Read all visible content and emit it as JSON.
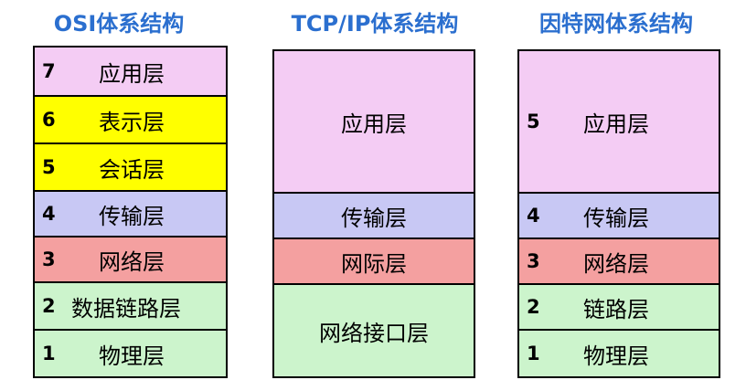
{
  "osi": {
    "title": "OSI体系结构",
    "layers": [
      {
        "num": "7",
        "name": "应用层"
      },
      {
        "num": "6",
        "name": "表示层"
      },
      {
        "num": "5",
        "name": "会话层"
      },
      {
        "num": "4",
        "name": "传输层"
      },
      {
        "num": "3",
        "name": "网络层"
      },
      {
        "num": "2",
        "name": "数据链路层"
      },
      {
        "num": "1",
        "name": "物理层"
      }
    ]
  },
  "tcpip": {
    "title": "TCP/IP体系结构",
    "layers": [
      {
        "name": "应用层"
      },
      {
        "name": "传输层"
      },
      {
        "name": "网际层"
      },
      {
        "name": "网络接口层"
      }
    ]
  },
  "internet": {
    "title": "因特网体系结构",
    "layers": [
      {
        "num": "5",
        "name": "应用层"
      },
      {
        "num": "4",
        "name": "传输层"
      },
      {
        "num": "3",
        "name": "网络层"
      },
      {
        "num": "2",
        "name": "链路层"
      },
      {
        "num": "1",
        "name": "物理层"
      }
    ]
  },
  "colors": {
    "title": "#2b6fcf",
    "application": "#f4ccf4",
    "presentation_session": "#ffff00",
    "transport": "#c8c8f4",
    "network": "#f4a0a0",
    "link_physical": "#ccf4cc"
  }
}
